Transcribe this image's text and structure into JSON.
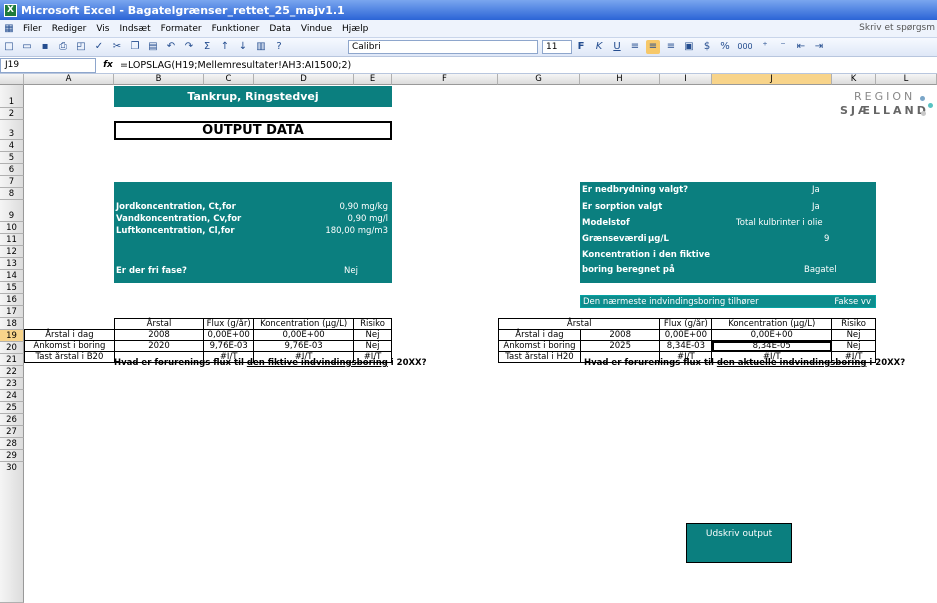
{
  "window": {
    "title": "Microsoft Excel - Bagatelgrænser_rettet_25_majv1.1"
  },
  "menu": {
    "items": [
      "Filer",
      "Rediger",
      "Vis",
      "Indsæt",
      "Formater",
      "Funktioner",
      "Data",
      "Vindue",
      "Hjælp"
    ],
    "help_prompt": "Skriv et spørgsm"
  },
  "toolbar": {
    "font": "Calibri",
    "size": "11",
    "percent": "%",
    "thousands": "000"
  },
  "formula_bar": {
    "name_box": "J19",
    "formula": "=LOPSLAG(H19;Mellemresultater!AH3:AI1500;2)"
  },
  "columns": [
    "A",
    "B",
    "C",
    "D",
    "E",
    "F",
    "G",
    "H",
    "I",
    "J",
    "K",
    "L"
  ],
  "rows": [
    "1",
    "2",
    "3",
    "4",
    "5",
    "6",
    "7",
    "8",
    "9",
    "10",
    "11",
    "12",
    "13",
    "14",
    "15",
    "16",
    "17",
    "18",
    "19",
    "20",
    "21",
    "22",
    "23",
    "24",
    "25",
    "26",
    "27",
    "28",
    "29",
    "30"
  ],
  "header": {
    "site": "Tankrup, Ringstedvej",
    "output_title": "OUTPUT DATA"
  },
  "logo": {
    "line1": "REGION",
    "line2": "SJÆLLAND"
  },
  "left_box": {
    "jord_label": "Jordkoncentration, Ct,for",
    "jord_value": "0,90 mg/kg",
    "vand_label": "Vandkoncentration, Cv,for",
    "vand_value": "0,90 mg/l",
    "luft_label": "Luftkoncentration, Cl,for",
    "luft_value": "180,00 mg/m3",
    "fri_label": "Er der fri fase?",
    "fri_value": "Nej"
  },
  "right_box": {
    "ned_label": "Er nedbrydning valgt?",
    "ned_value": "Ja",
    "sorp_label": "Er sorption valgt",
    "sorp_value": "Ja",
    "model_label": "Modelstof",
    "model_value": "Total kulbrinter i olie",
    "graense_label": "Grænseværdi",
    "graense_unit": "µg/L",
    "graense_value": "9",
    "konc_label_1": "Koncentration i den fiktive",
    "konc_label_2": "boring beregnet på",
    "konc_value": "Bagatel"
  },
  "nearest": {
    "label": "Den nærmeste indvindingsboring tilhører",
    "value": "Fakse vv"
  },
  "left_question": {
    "prefix": "Hvad er forurenings flux til ",
    "link": "den fiktive indvindingsboring",
    "suffix": " i 20XX?"
  },
  "right_question": {
    "prefix": "Hvad er forurenings flux til ",
    "link": "den aktuelle indvindingsboring",
    "suffix": " i 20XX?"
  },
  "left_table": {
    "headers": [
      "Årstal",
      "Flux (g/år)",
      "Koncentration (µg/L)",
      "Risiko"
    ],
    "rows": [
      [
        "Årstal i dag",
        "2008",
        "0,00E+00",
        "0,00E+00",
        "Nej"
      ],
      [
        "Ankomst i boring",
        "2020",
        "9,76E-03",
        "9,76E-03",
        "Nej"
      ],
      [
        "Tast årstal i B20",
        "",
        "#I/T",
        "#I/T",
        "#I/T"
      ]
    ]
  },
  "right_table": {
    "headers": [
      "Årstal",
      "Flux (g/år)",
      "Koncentration (µg/L)",
      "Risiko"
    ],
    "rows": [
      [
        "Årstal i dag",
        "2008",
        "0,00E+00",
        "0,00E+00",
        "Nej"
      ],
      [
        "Ankomst i boring",
        "2025",
        "8,34E-03",
        "8,34E-05",
        "Nej"
      ],
      [
        "Tast årstal i H20",
        "",
        "#I/T",
        "#I/T",
        "#I/T"
      ]
    ]
  },
  "print_button": {
    "label": "Udskriv output"
  }
}
